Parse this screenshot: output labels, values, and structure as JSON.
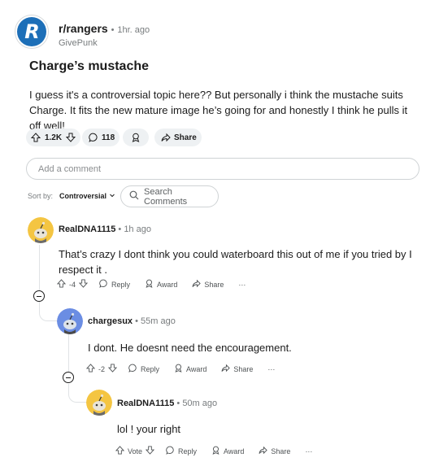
{
  "post": {
    "subreddit": "r/rangers",
    "separator": "•",
    "time": "1hr. ago",
    "author": "GivePunk",
    "logo_letter": "R",
    "title": "Charge’s mustache",
    "body": "I guess it's a controversial topic here?? But personally i think the mustache suits Charge. It fits the new mature image he’s going for and honestly I think he pulls it off well!",
    "score": "1.2K",
    "comment_count": "118",
    "share_label": "Share"
  },
  "comment_box": {
    "placeholder": "Add a comment"
  },
  "sort": {
    "label": "Sort by:",
    "value": "Controversial",
    "search_placeholder": "Search Comments"
  },
  "comments": [
    {
      "user": "RealDNA1115",
      "time": "1h ago",
      "text_line1": "That’s crazy I dont think you could waterboard this out of me if you tried by I",
      "text_line2": "respect it .",
      "score": "-4",
      "reply_label": "Reply",
      "award_label": "Award",
      "share_label": "Share",
      "more": "···"
    },
    {
      "user": "chargesux",
      "time": "55m ago",
      "text": "I dont. He doesnt need the encouragement.",
      "score": "-2",
      "reply_label": "Reply",
      "award_label": "Award",
      "share_label": "Share",
      "more": "···"
    },
    {
      "user": "RealDNA1115",
      "time": "50m ago",
      "text": "lol ! your right",
      "score": "Vote",
      "reply_label": "Reply",
      "award_label": "Award",
      "share_label": "Share",
      "more": "···"
    }
  ],
  "colors": {
    "logo_blue": "#1d6fb8",
    "avatar_yellow": "#f4c542",
    "avatar_blue": "#6b8de3",
    "pill_bg": "#eef1f3",
    "muted_text": "#787c7e"
  },
  "icons": [
    "upvote-icon",
    "downvote-icon",
    "comment-icon",
    "award-icon",
    "share-icon",
    "search-icon",
    "chevron-down-icon",
    "collapse-icon",
    "snoo-avatar"
  ]
}
